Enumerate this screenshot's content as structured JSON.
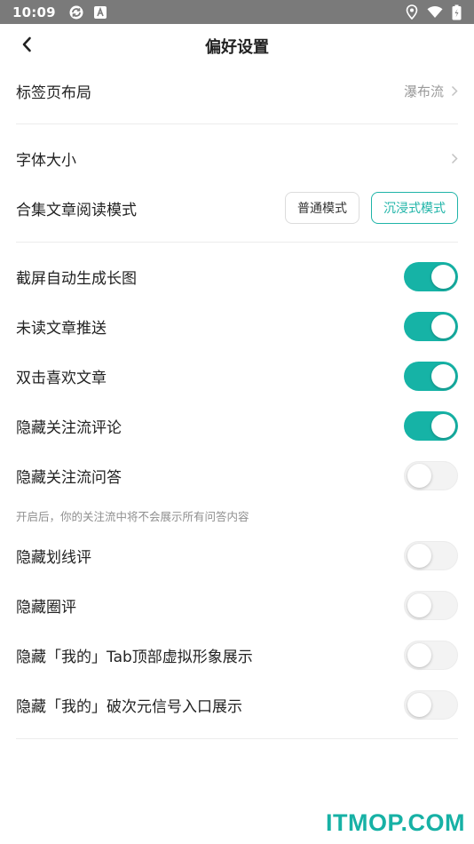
{
  "status_bar": {
    "time": "10:09"
  },
  "header": {
    "title": "偏好设置"
  },
  "settings": {
    "tab_layout": {
      "label": "标签页布局",
      "value": "瀑布流"
    },
    "font_size": {
      "label": "字体大小"
    },
    "reading_mode": {
      "label": "合集文章阅读模式",
      "options": [
        "普通模式",
        "沉浸式模式"
      ],
      "selected": "沉浸式模式"
    },
    "toggles": [
      {
        "label": "截屏自动生成长图",
        "on": true
      },
      {
        "label": "未读文章推送",
        "on": true
      },
      {
        "label": "双击喜欢文章",
        "on": true
      },
      {
        "label": "隐藏关注流评论",
        "on": true
      },
      {
        "label": "隐藏关注流问答",
        "on": false
      }
    ],
    "qa_hint": "开启后，你的关注流中将不会展示所有问答内容",
    "toggles2": [
      {
        "label": "隐藏划线评",
        "on": false
      },
      {
        "label": "隐藏圈评",
        "on": false
      },
      {
        "label": "隐藏「我的」Tab顶部虚拟形象展示",
        "on": false
      },
      {
        "label": "隐藏「我的」破次元信号入口展示",
        "on": false
      }
    ]
  },
  "watermark": "ITMOP.COM",
  "colors": {
    "accent": "#16b3a6",
    "status_bar": "#7a7a7a"
  }
}
